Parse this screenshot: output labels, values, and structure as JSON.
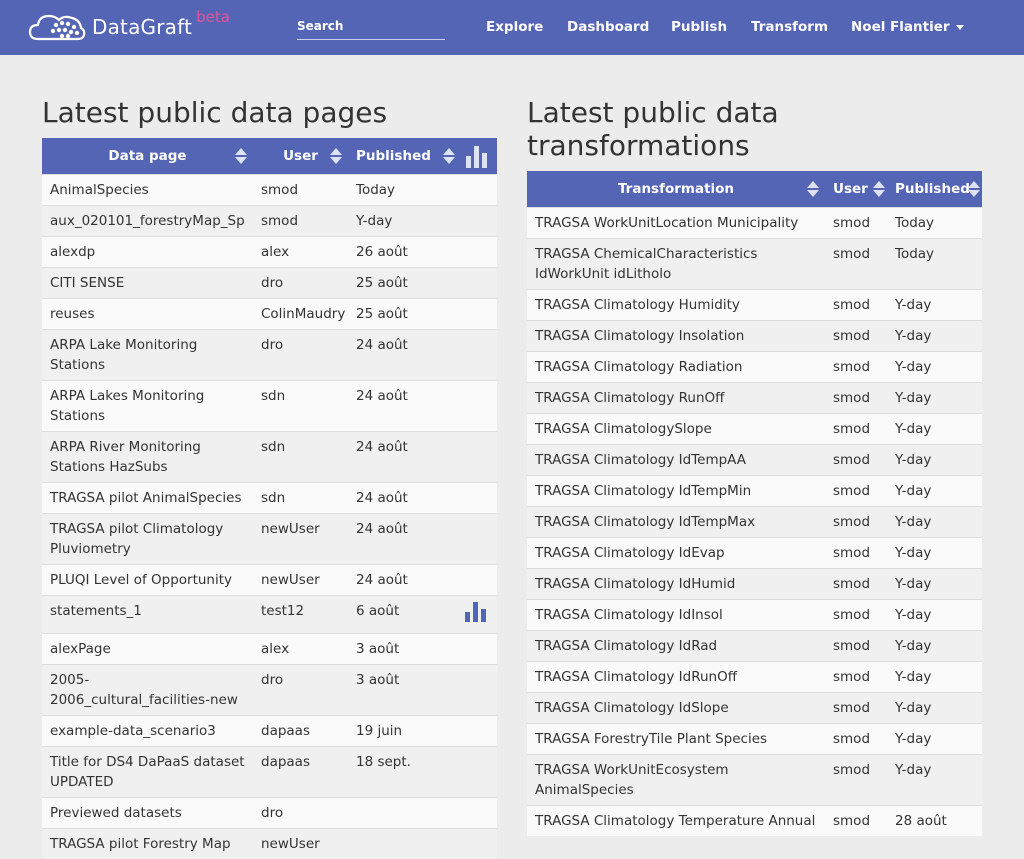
{
  "header": {
    "brand_name": "DataGraft",
    "brand_badge": "beta",
    "search_placeholder": "Search",
    "nav": [
      "Explore",
      "Dashboard",
      "Publish",
      "Transform"
    ],
    "user_menu": "Noel Flantier",
    "colors": {
      "navbar": "#5565b6",
      "badge": "#e84f9a"
    }
  },
  "pages_section": {
    "title": "Latest public data pages",
    "columns": [
      "Data page",
      "User",
      "Published"
    ],
    "header_icon": "bar-chart-icon",
    "rows": [
      {
        "name": "AnimalSpecies",
        "user": "smod",
        "published": "Today"
      },
      {
        "name": "aux_020101_forestryMap_Sp",
        "user": "smod",
        "published": "Y-day"
      },
      {
        "name": "alexdp",
        "user": "alex",
        "published": "26 août"
      },
      {
        "name": "CITI SENSE",
        "user": "dro",
        "published": "25 août"
      },
      {
        "name": "reuses",
        "user": "ColinMaudry",
        "published": "25 août"
      },
      {
        "name": "ARPA Lake Monitoring Stations",
        "user": "dro",
        "published": "24 août"
      },
      {
        "name": "ARPA Lakes Monitoring Stations",
        "user": "sdn",
        "published": "24 août"
      },
      {
        "name": "ARPA River Monitoring Stations HazSubs",
        "user": "sdn",
        "published": "24 août"
      },
      {
        "name": "TRAGSA pilot AnimalSpecies",
        "user": "sdn",
        "published": "24 août"
      },
      {
        "name": "TRAGSA pilot Climatology Pluviometry",
        "user": "newUser",
        "published": "24 août"
      },
      {
        "name": "PLUQI Level of Opportunity",
        "user": "newUser",
        "published": "24 août"
      },
      {
        "name": "statements_1",
        "user": "test12",
        "published": "6 août",
        "icon": "bar-chart-icon"
      },
      {
        "name": "alexPage",
        "user": "alex",
        "published": "3 août"
      },
      {
        "name": "2005-2006_cultural_facilities-new",
        "user": "dro",
        "published": "3 août"
      },
      {
        "name": "example-data_scenario3",
        "user": "dapaas",
        "published": "19 juin"
      },
      {
        "name": "Title for DS4 DaPaaS dataset UPDATED",
        "user": "dapaas",
        "published": "18 sept."
      },
      {
        "name": "Previewed datasets",
        "user": "dro",
        "published": ""
      },
      {
        "name": "TRAGSA pilot Forestry Map",
        "user": "newUser",
        "published": ""
      }
    ]
  },
  "transforms_section": {
    "title_line1": "Latest public data",
    "title_line2": "transformations",
    "columns": [
      "Transformation",
      "User",
      "Published"
    ],
    "rows": [
      {
        "name": "TRAGSA WorkUnitLocation Municipality",
        "user": "smod",
        "published": "Today"
      },
      {
        "name": "TRAGSA ChemicalCharacteristics IdWorkUnit idLitholo",
        "user": "smod",
        "published": "Today"
      },
      {
        "name": "TRAGSA Climatology Humidity",
        "user": "smod",
        "published": "Y-day"
      },
      {
        "name": "TRAGSA Climatology Insolation",
        "user": "smod",
        "published": "Y-day"
      },
      {
        "name": "TRAGSA Climatology Radiation",
        "user": "smod",
        "published": "Y-day"
      },
      {
        "name": "TRAGSA Climatology RunOff",
        "user": "smod",
        "published": "Y-day"
      },
      {
        "name": "TRAGSA ClimatologySlope",
        "user": "smod",
        "published": "Y-day"
      },
      {
        "name": "TRAGSA Climatology IdTempAA",
        "user": "smod",
        "published": "Y-day"
      },
      {
        "name": "TRAGSA Climatology IdTempMin",
        "user": "smod",
        "published": "Y-day"
      },
      {
        "name": "TRAGSA Climatology IdTempMax",
        "user": "smod",
        "published": "Y-day"
      },
      {
        "name": "TRAGSA Climatology IdEvap",
        "user": "smod",
        "published": "Y-day"
      },
      {
        "name": "TRAGSA Climatology IdHumid",
        "user": "smod",
        "published": "Y-day"
      },
      {
        "name": "TRAGSA Climatology IdInsol",
        "user": "smod",
        "published": "Y-day"
      },
      {
        "name": "TRAGSA Climatology IdRad",
        "user": "smod",
        "published": "Y-day"
      },
      {
        "name": "TRAGSA Climatology IdRunOff",
        "user": "smod",
        "published": "Y-day"
      },
      {
        "name": "TRAGSA Climatology IdSlope",
        "user": "smod",
        "published": "Y-day"
      },
      {
        "name": "TRAGSA ForestryTile Plant Species",
        "user": "smod",
        "published": "Y-day"
      },
      {
        "name": "TRAGSA WorkUnitEcosystem AnimalSpecies",
        "user": "smod",
        "published": "Y-day"
      },
      {
        "name": "TRAGSA Climatology Temperature Annual",
        "user": "smod",
        "published": "28 août"
      }
    ]
  }
}
